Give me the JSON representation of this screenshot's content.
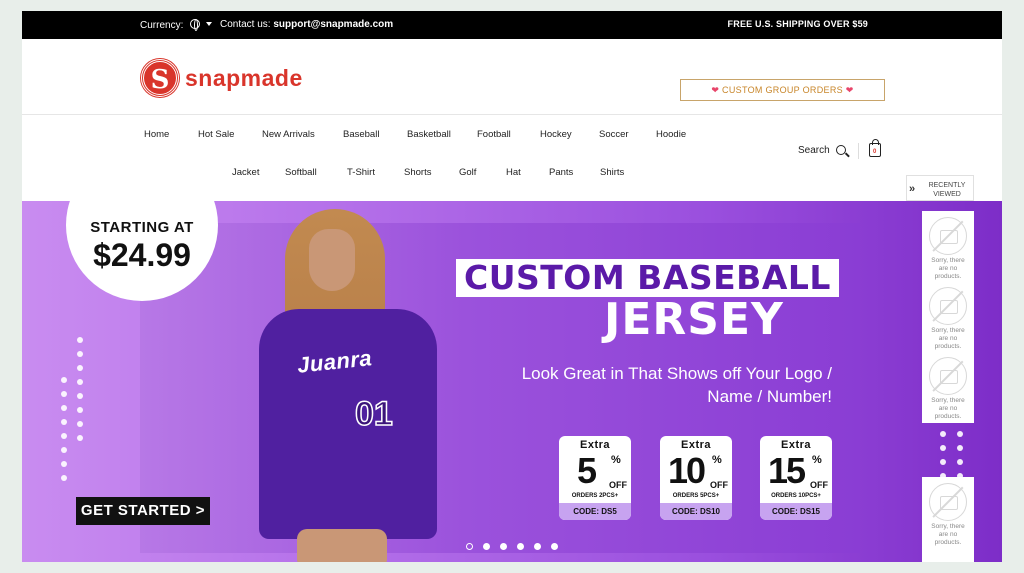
{
  "topbar": {
    "currency_label": "Currency:",
    "contact_label": "Contact us:",
    "contact_email": "support@snapmade.com",
    "shipping": "FREE U.S. SHIPPING OVER $59"
  },
  "header": {
    "logo_mark": "S",
    "logo_text": "snapmade",
    "custom_group_orders": "CUSTOM GROUP ORDERS",
    "heart": "❤"
  },
  "nav": {
    "row1": [
      "Home",
      "Hot Sale",
      "New Arrivals",
      "Baseball",
      "Basketball",
      "Football",
      "Hockey",
      "Soccer",
      "Hoodie"
    ],
    "row2": [
      "Jacket",
      "Softball",
      "T-Shirt",
      "Shorts",
      "Golf",
      "Hat",
      "Pants",
      "Shirts"
    ],
    "search_label": "Search",
    "cart_count": "0"
  },
  "banner": {
    "starting_at": "STARTING AT",
    "price": "$24.99",
    "headline_1": "CUSTOM BASEBALL",
    "headline_2": "JERSEY",
    "tagline": "Look Great in That Shows off Your Logo / Name / Number!",
    "jersey_name": "Juanra",
    "jersey_number": "01",
    "coupons": [
      {
        "extra": "Extra",
        "value": "5",
        "pct": "%",
        "off": "OFF",
        "orders": "ORDERS 2PCS+",
        "code": "CODE: DS5"
      },
      {
        "extra": "Extra",
        "value": "10",
        "pct": "%",
        "off": "OFF",
        "orders": "ORDERS 5PCS+",
        "code": "CODE: DS10"
      },
      {
        "extra": "Extra",
        "value": "15",
        "pct": "%",
        "off": "OFF",
        "orders": "ORDERS 10PCS+",
        "code": "CODE: DS15"
      }
    ],
    "cta": "GET STARTED >",
    "slide_count": 6,
    "active_slide": 1
  },
  "recently_viewed": {
    "title": "RECENTLY VIEWED",
    "arrow": "»",
    "empty_text": "Sorry, there are no products."
  },
  "colors": {
    "brand_red": "#d9352b",
    "banner_purple": "#8a3dd4",
    "cta_gold": "#c8862a"
  }
}
